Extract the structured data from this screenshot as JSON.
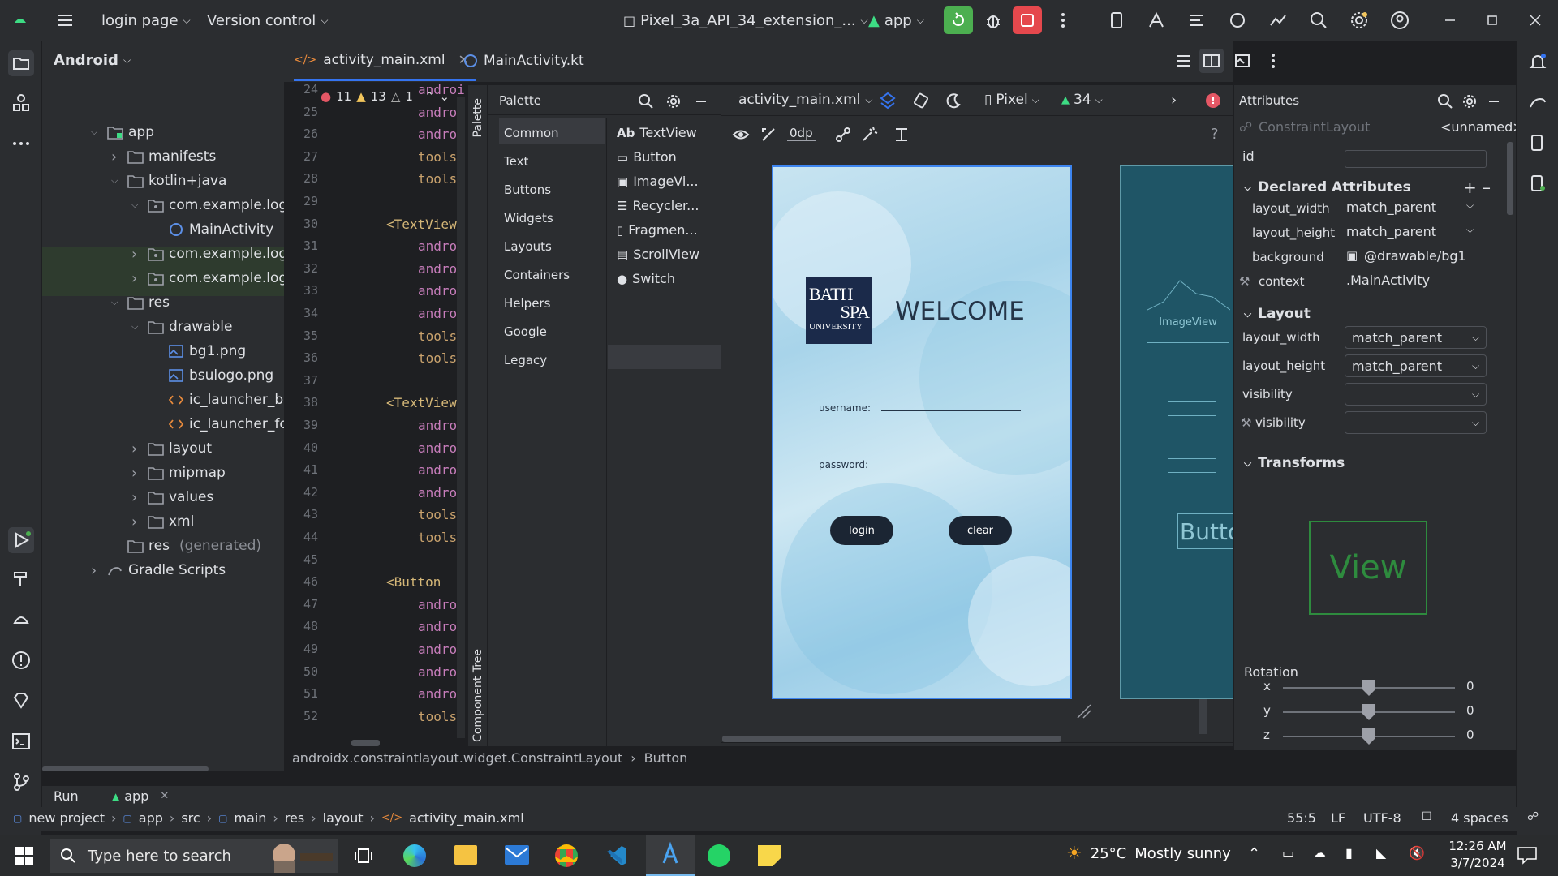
{
  "topbar": {
    "project": "login page",
    "vcs": "Version control",
    "device": "Pixel_3a_API_34_extension_...",
    "run_config": "app"
  },
  "project_panel": {
    "title": "Android",
    "items": [
      {
        "label": "app",
        "indent": 0,
        "arrow": "down",
        "icon": "folder-module"
      },
      {
        "label": "manifests",
        "indent": 1,
        "arrow": "right",
        "icon": "folder"
      },
      {
        "label": "kotlin+java",
        "indent": 1,
        "arrow": "down",
        "icon": "folder"
      },
      {
        "label": "com.example.loginpage",
        "indent": 2,
        "arrow": "down",
        "icon": "package"
      },
      {
        "label": "MainActivity",
        "indent": 3,
        "arrow": "",
        "icon": "kotlin-class"
      },
      {
        "label": "com.example.loginpage",
        "indent": 2,
        "arrow": "right",
        "icon": "package",
        "muted": true
      },
      {
        "label": "com.example.loginpage",
        "indent": 2,
        "arrow": "right",
        "icon": "package",
        "muted": true
      },
      {
        "label": "res",
        "indent": 1,
        "arrow": "down",
        "icon": "folder"
      },
      {
        "label": "drawable",
        "indent": 2,
        "arrow": "down",
        "icon": "folder"
      },
      {
        "label": "bg1.png",
        "indent": 3,
        "arrow": "",
        "icon": "image"
      },
      {
        "label": "bsulogo.png",
        "indent": 3,
        "arrow": "",
        "icon": "image"
      },
      {
        "label": "ic_launcher_backgrou",
        "indent": 3,
        "arrow": "",
        "icon": "xml"
      },
      {
        "label": "ic_launcher_foregrou",
        "indent": 3,
        "arrow": "",
        "icon": "xml"
      },
      {
        "label": "layout",
        "indent": 2,
        "arrow": "right",
        "icon": "folder"
      },
      {
        "label": "mipmap",
        "indent": 2,
        "arrow": "right",
        "icon": "folder"
      },
      {
        "label": "values",
        "indent": 2,
        "arrow": "right",
        "icon": "folder"
      },
      {
        "label": "xml",
        "indent": 2,
        "arrow": "right",
        "icon": "folder"
      },
      {
        "label": "res",
        "suffix": "(generated)",
        "indent": 1,
        "arrow": "",
        "icon": "folder"
      },
      {
        "label": "Gradle Scripts",
        "indent": 0,
        "arrow": "right",
        "icon": "gradle"
      }
    ]
  },
  "tabs": [
    {
      "label": "activity_main.xml",
      "active": true
    },
    {
      "label": "MainActivity.kt",
      "active": false
    }
  ],
  "inspections": {
    "errors": "11",
    "warnings": "13",
    "weak": "1"
  },
  "code": {
    "lines": [
      {
        "n": "24",
        "text": "androi"
      },
      {
        "n": "25",
        "text": "androi"
      },
      {
        "n": "26",
        "text": "androi"
      },
      {
        "n": "27",
        "text": "tools:"
      },
      {
        "n": "28",
        "text": "tools:"
      },
      {
        "n": "29",
        "text": ""
      },
      {
        "n": "30",
        "text": "<TextView"
      },
      {
        "n": "31",
        "text": "androi"
      },
      {
        "n": "32",
        "text": "androi"
      },
      {
        "n": "33",
        "text": "androi"
      },
      {
        "n": "34",
        "text": "androi"
      },
      {
        "n": "35",
        "text": "tools:"
      },
      {
        "n": "36",
        "text": "tools:"
      },
      {
        "n": "37",
        "text": ""
      },
      {
        "n": "38",
        "text": "<TextView"
      },
      {
        "n": "39",
        "text": "androi"
      },
      {
        "n": "40",
        "text": "androi"
      },
      {
        "n": "41",
        "text": "androi"
      },
      {
        "n": "42",
        "text": "androi"
      },
      {
        "n": "43",
        "text": "tools:"
      },
      {
        "n": "44",
        "text": "tools:"
      },
      {
        "n": "45",
        "text": ""
      },
      {
        "n": "46",
        "text": "<Button"
      },
      {
        "n": "47",
        "text": "androi"
      },
      {
        "n": "48",
        "text": "androi"
      },
      {
        "n": "49",
        "text": "androi"
      },
      {
        "n": "50",
        "text": "androi"
      },
      {
        "n": "51",
        "text": "androi"
      },
      {
        "n": "52",
        "text": "tools:"
      }
    ]
  },
  "palette": {
    "title": "Palette",
    "side_tab": "Palette",
    "component_tree": "Component Tree",
    "categories": [
      "Common",
      "Text",
      "Buttons",
      "Widgets",
      "Layouts",
      "Containers",
      "Helpers",
      "Google",
      "Legacy"
    ],
    "items": [
      {
        "label": "TextView",
        "prefix": "Ab"
      },
      {
        "label": "Button"
      },
      {
        "label": "ImageVi..."
      },
      {
        "label": "Recycler..."
      },
      {
        "label": "Fragmen..."
      },
      {
        "label": "ScrollView"
      },
      {
        "label": "Switch"
      }
    ]
  },
  "designer": {
    "file": "activity_main.xml",
    "device": "Pixel",
    "api": "34",
    "margin": "0dp",
    "preview": {
      "logo_line1": "BATH",
      "logo_line2": "SPA",
      "logo_line3": "UNIVERSITY",
      "welcome": "WELCOME",
      "username_label": "username:",
      "password_label": "password:",
      "login": "login",
      "clear": "clear"
    },
    "blueprint": {
      "image_label": "ImageView",
      "button_label": "Butto"
    }
  },
  "attributes": {
    "title": "Attributes",
    "component": "ConstraintLayout",
    "name": "<unnamed>",
    "id_label": "id",
    "declared_title": "Declared Attributes",
    "declared": [
      {
        "k": "layout_width",
        "v": "match_parent"
      },
      {
        "k": "layout_height",
        "v": "match_parent"
      },
      {
        "k": "background",
        "v": "@drawable/bg1"
      },
      {
        "k": "context",
        "v": ".MainActivity"
      }
    ],
    "layout_title": "Layout",
    "layout": [
      {
        "k": "layout_width",
        "v": "match_parent"
      },
      {
        "k": "layout_height",
        "v": "match_parent"
      },
      {
        "k": "visibility",
        "v": ""
      },
      {
        "k": "visibility",
        "v": ""
      }
    ],
    "transforms_title": "Transforms",
    "view_label": "View",
    "rotation_title": "Rotation",
    "rotation": [
      {
        "axis": "x",
        "value": "0"
      },
      {
        "axis": "y",
        "value": "0"
      },
      {
        "axis": "z",
        "value": "0"
      }
    ]
  },
  "breadcrumb_editor": [
    "androidx.constraintlayout.widget.ConstraintLayout",
    "Button"
  ],
  "runbar": {
    "run": "Run",
    "config": "app"
  },
  "statusbar": {
    "path": [
      "new project",
      "app",
      "src",
      "main",
      "res",
      "layout",
      "activity_main.xml"
    ],
    "position": "55:5",
    "line_sep": "LF",
    "encoding": "UTF-8",
    "indent": "4 spaces"
  },
  "taskbar": {
    "search_placeholder": "Type here to search",
    "weather_temp": "25°C",
    "weather_desc": "Mostly sunny",
    "time": "12:26 AM",
    "date": "3/7/2024"
  },
  "colors": {
    "accent": "#3574f0",
    "run_green": "#4caf50",
    "stop_red": "#e5484d",
    "error": "#e55765",
    "warning": "#f2c55c",
    "xml_tag": "#d5b778",
    "attr": "#c77dbb"
  }
}
